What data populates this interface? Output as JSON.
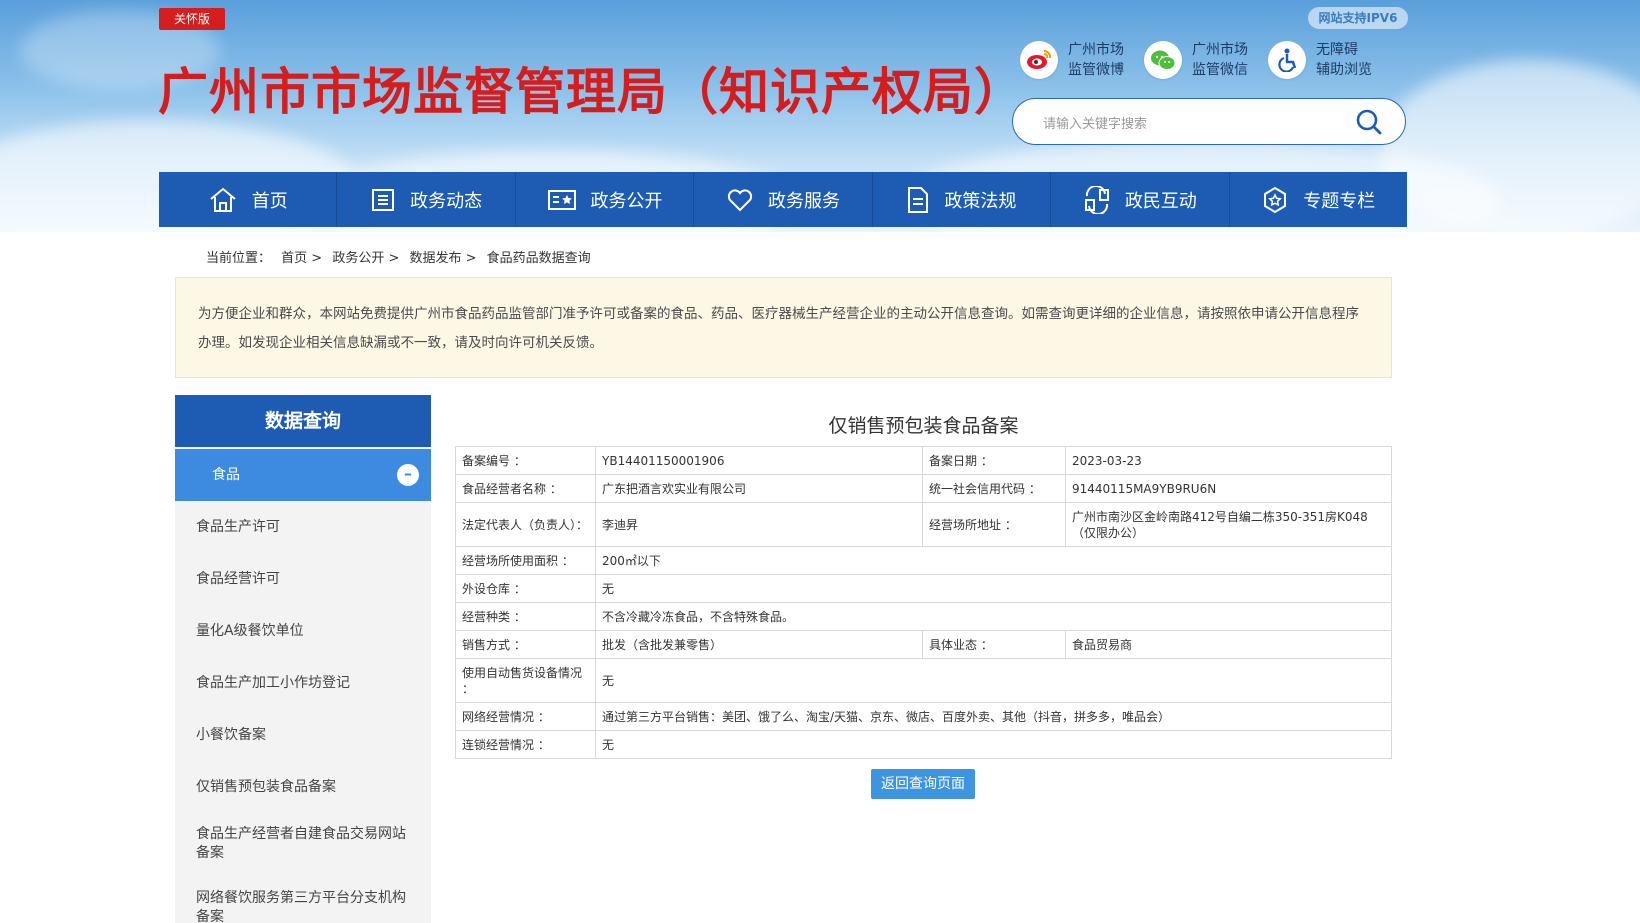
{
  "header": {
    "care_badge": "关怀版",
    "site_title": "广州市市场监督管理局（知识产权局）",
    "ipv6": "网站支持IPV6",
    "quick_links": [
      {
        "icon": "weibo-icon",
        "line1": "广州市场",
        "line2": "监管微博"
      },
      {
        "icon": "wechat-icon",
        "line1": "广州市场",
        "line2": "监管微信"
      },
      {
        "icon": "accessibility-icon",
        "line1": "无障碍",
        "line2": "辅助浏览"
      }
    ],
    "search_placeholder": "请输入关键字搜索"
  },
  "nav": [
    {
      "label": "首页",
      "icon": "home-icon"
    },
    {
      "label": "政务动态",
      "icon": "news-icon"
    },
    {
      "label": "政务公开",
      "icon": "open-govt-icon"
    },
    {
      "label": "政务服务",
      "icon": "heart-icon"
    },
    {
      "label": "政策法规",
      "icon": "document-icon"
    },
    {
      "label": "政民互动",
      "icon": "interaction-icon"
    },
    {
      "label": "专题专栏",
      "icon": "star-badge-icon"
    }
  ],
  "breadcrumb": {
    "prefix": "当前位置：",
    "items": [
      "首页 >",
      "政务公开 >",
      "数据发布 >",
      "食品药品数据查询"
    ]
  },
  "notice": "为方便企业和群众，本网站免费提供广州市食品药品监管部门准予许可或备案的食品、药品、医疗器械生产经营企业的主动公开信息查询。如需查询更详细的企业信息，请按照依申请公开信息程序办理。如发现企业相关信息缺漏或不一致，请及时向许可机关反馈。",
  "sidebar": {
    "title": "数据查询",
    "active": "食品",
    "active_toggle": "–",
    "items": [
      "食品生产许可",
      "食品经营许可",
      "量化A级餐饮单位",
      "食品生产加工小作坊登记",
      "小餐饮备案",
      "仅销售预包装食品备案",
      "食品生产经营者自建食品交易网站备案",
      "网络餐饮服务第三方平台分支机构备案"
    ]
  },
  "record": {
    "title": "仅销售预包装食品备案",
    "rows": [
      {
        "l1": "备案编号 ：",
        "v1": "YB14401150001906",
        "l2": "备案日期 ：",
        "v2": "2023-03-23"
      },
      {
        "l1": "食品经营者名称 ：",
        "v1": "广东把酒言欢实业有限公司",
        "l2": "统一社会信用代码 ：",
        "v2": "91440115MA9YB9RU6N"
      },
      {
        "l1": "法定代表人（负责人）：",
        "v1": "李迪昇",
        "l2": "经营场所地址 ：",
        "v2": "广州市南沙区金岭南路412号自编二栋350-351房K048（仅限办公）"
      },
      {
        "l1": "经营场所使用面积 ：",
        "v": "200㎡以下"
      },
      {
        "l1": "外设仓库 ：",
        "v": "无"
      },
      {
        "l1": "经营种类 ：",
        "v": "不含冷藏冷冻食品，不含特殊食品。"
      },
      {
        "l1": "销售方式 ：",
        "v1": "批发（含批发兼零售）",
        "l2": "具体业态 ：",
        "v2": "食品贸易商"
      },
      {
        "l1": "使用自动售货设备情况 ：",
        "v": "无"
      },
      {
        "l1": "网络经营情况 ：",
        "v": "通过第三方平台销售：美团、饿了么、淘宝/天猫、京东、微店、百度外卖、其他（抖音，拼多多，唯品会）"
      },
      {
        "l1": "连锁经营情况 ：",
        "v": "无"
      }
    ],
    "back_button": "返回查询页面"
  },
  "colors": {
    "brand_red": "#d41d1d",
    "nav_blue": "#1e5cb3",
    "active_blue": "#3d8be0"
  }
}
